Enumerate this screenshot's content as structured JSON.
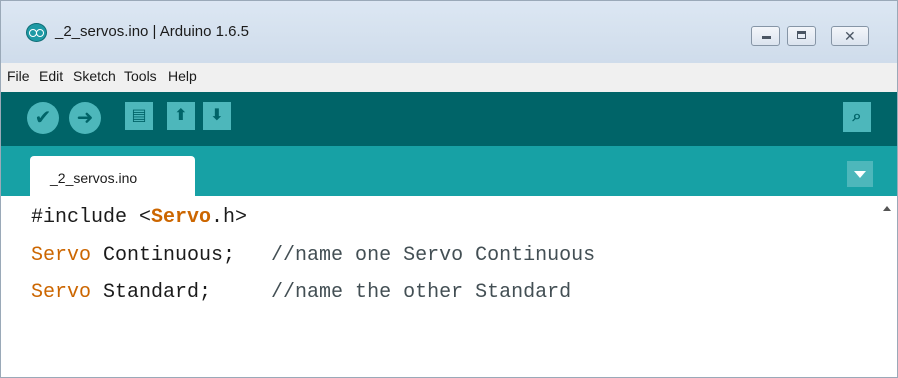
{
  "window": {
    "title": "_2_servos.ino | Arduino 1.6.5",
    "minimize_glyph": "▭",
    "maximize_glyph": "□",
    "close_glyph": "✕"
  },
  "menu": [
    "File",
    "Edit",
    "Sketch",
    "Tools",
    "Help"
  ],
  "toolbar": {
    "verify_icon": "check-icon",
    "upload_icon": "arrow-right-icon",
    "new_icon": "new-file-icon",
    "open_icon": "open-arrow-up-icon",
    "save_icon": "save-arrow-down-icon",
    "serial_monitor_icon": "magnifier-icon",
    "verify_glyph": "✔",
    "upload_glyph": "➜",
    "new_glyph": "▤",
    "open_glyph": "⬆",
    "save_glyph": "⬇",
    "serial_glyph": "⌕"
  },
  "tabs": [
    {
      "label": "_2_servos.ino",
      "active": true
    }
  ],
  "editor": {
    "lines": [
      {
        "pre": "#include <",
        "kw": "Servo",
        "post": ".h>",
        "comment": ""
      },
      {
        "pre": "",
        "kw": "Servo",
        "post": " Continuous;   ",
        "comment": "//name one Servo Continuous"
      },
      {
        "pre": "",
        "kw": "Servo",
        "post": " Standard;     ",
        "comment": "//name the other Standard"
      }
    ]
  },
  "colors": {
    "toolbar_bg": "#006468",
    "tabrow_bg": "#17a1a5",
    "button_bg": "#4db7bb",
    "keyword": "#cc6600"
  }
}
